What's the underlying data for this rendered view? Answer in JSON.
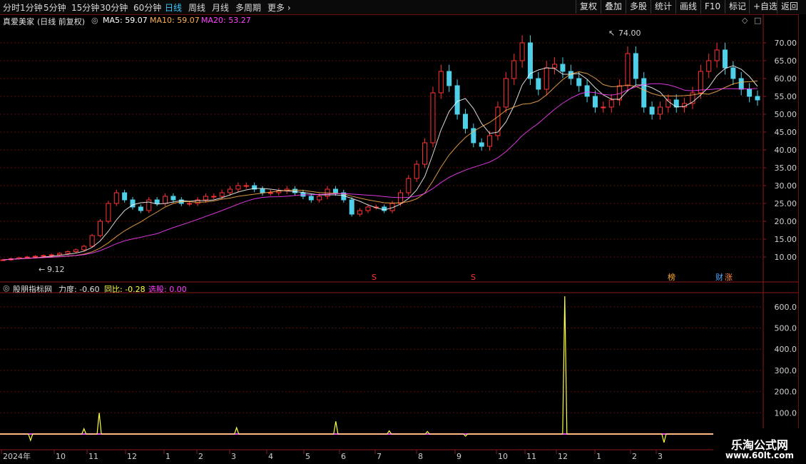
{
  "toolbar": {
    "periods": [
      "分时",
      "1分钟",
      "5分钟",
      "15分钟",
      "30分钟",
      "60分钟",
      "日线",
      "周线",
      "月线",
      "多周期",
      "更多"
    ],
    "active_period": "日线",
    "more_chevron_icon": "chevron-right-icon",
    "buttons": [
      "复权",
      "叠加",
      "多股",
      "统计",
      "画线",
      "F10",
      "标记",
      "+自选",
      "返回"
    ]
  },
  "price_panel": {
    "stock_name": "真爱美家",
    "qualifier": "(日线 前复权)",
    "ma5_label": "MA5: 59.07",
    "ma10_label": "MA10: 59.07",
    "ma20_label": "MA20: 53.27",
    "high_marker": "74.00",
    "low_marker": "9.12",
    "y_ticks": [
      "70.00",
      "65.00",
      "60.00",
      "55.00",
      "50.00",
      "45.00",
      "40.00",
      "35.00",
      "30.00",
      "25.00",
      "20.00",
      "15.00",
      "10.00"
    ],
    "markers": [
      "S",
      "S",
      "榜",
      "财",
      "涨"
    ]
  },
  "indicator_panel": {
    "name": "股朋指标网",
    "lidu_label": "力度: -0.60",
    "tongbi_label": "同比: -0.28",
    "xuangu_label": "选股: 0.00",
    "y_ticks": [
      "600.0",
      "500.0",
      "400.0",
      "300.0",
      "200.0",
      "100.0"
    ]
  },
  "x_axis": [
    "2024年",
    "10",
    "11",
    "12",
    "1",
    "2",
    "3",
    "4",
    "5",
    "6",
    "7",
    "8",
    "9",
    "10",
    "11",
    "12",
    "1",
    "2",
    "3"
  ],
  "watermark": {
    "line1": "乐淘公式网",
    "line2": "www.60lt.com"
  },
  "colors": {
    "up": "#ff3333",
    "down": "#4fd0e8",
    "ma5": "#ffffff",
    "ma10": "#ffb050",
    "ma20": "#ff40ff",
    "indicator": "#ffff40"
  },
  "chart_data": {
    "type": "candlestick",
    "y_range": [
      5,
      75
    ],
    "approx_closes": [
      9.2,
      9.5,
      9.8,
      10,
      10.2,
      10.4,
      10.6,
      11,
      11.5,
      12,
      13,
      16,
      20,
      25,
      28,
      26,
      24,
      23,
      26,
      25,
      27,
      26,
      25,
      25,
      26,
      27,
      27,
      28,
      29,
      30,
      30,
      29,
      28,
      28,
      28.5,
      29,
      28,
      27,
      26,
      27,
      29,
      28,
      26,
      22,
      23,
      24,
      24,
      23,
      25,
      28,
      32,
      36,
      42,
      56,
      62,
      58,
      50,
      46,
      42,
      41,
      44,
      52,
      60,
      65,
      70,
      60,
      57,
      63,
      64,
      62,
      60,
      58,
      55,
      52,
      52,
      54,
      58,
      67,
      60,
      52,
      50,
      52,
      54,
      52,
      53,
      56,
      62,
      65,
      68,
      63,
      60,
      57,
      55,
      54
    ],
    "indicator_spikes": [
      {
        "x": 0.04,
        "v": -30
      },
      {
        "x": 0.11,
        "v": 25
      },
      {
        "x": 0.13,
        "v": 100
      },
      {
        "x": 0.31,
        "v": 30
      },
      {
        "x": 0.44,
        "v": 60
      },
      {
        "x": 0.51,
        "v": 15
      },
      {
        "x": 0.56,
        "v": 12
      },
      {
        "x": 0.61,
        "v": -10
      },
      {
        "x": 0.74,
        "v": 650
      },
      {
        "x": 0.87,
        "v": -40
      }
    ]
  }
}
